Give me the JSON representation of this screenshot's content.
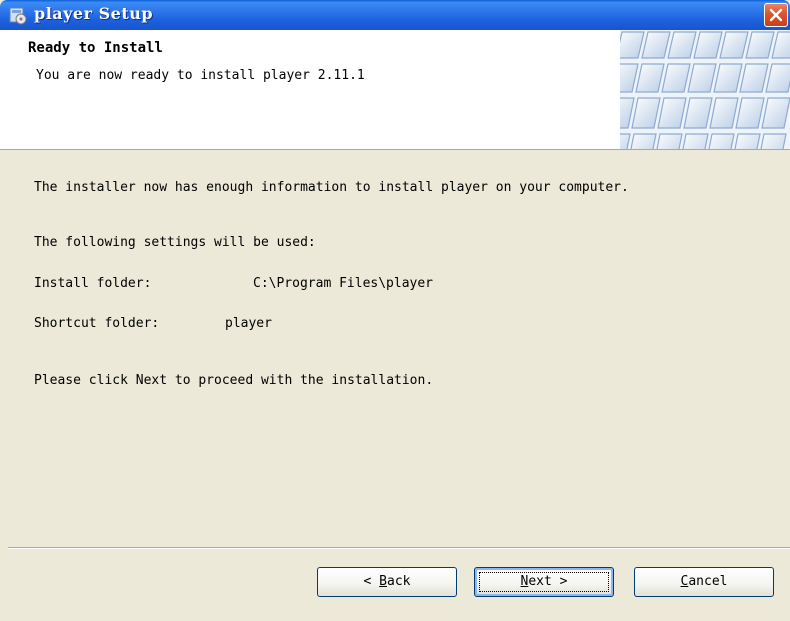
{
  "window": {
    "title": "player Setup"
  },
  "header": {
    "title": "Ready to Install",
    "subtitle": "You are now ready to install player 2.11.1"
  },
  "content": {
    "intro": "The installer now has enough information to install player on your computer.",
    "settings_heading": "The following settings will be used:",
    "install_folder_label": "Install folder:",
    "install_folder_value": "C:\\Program Files\\player",
    "shortcut_folder_label": "Shortcut folder:",
    "shortcut_folder_value": "player",
    "proceed_text": "Please click Next to proceed with the installation."
  },
  "buttons": {
    "back": {
      "prefix": "< ",
      "mnemonic": "B",
      "rest": "ack"
    },
    "next": {
      "mnemonic": "N",
      "rest": "ext",
      "suffix": " >"
    },
    "cancel": {
      "mnemonic": "C",
      "rest": "ancel"
    }
  },
  "icons": {
    "title": "installer-app-icon",
    "close": "close-icon",
    "header": "keyboard-keys-image"
  },
  "colors": {
    "titlebar": "#2c74ea",
    "close_button": "#d9542f",
    "dialog_background": "#ece9d8",
    "button_border": "#003c74"
  }
}
